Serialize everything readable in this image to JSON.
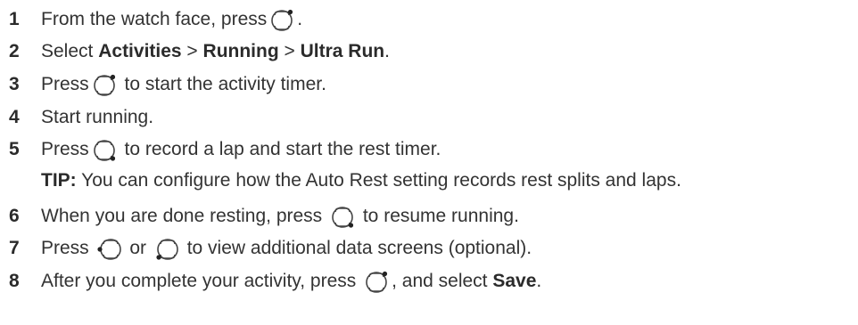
{
  "steps": [
    {
      "num": "1",
      "pre": "From the watch face, press ",
      "icon": "start-stop-button-icon",
      "post": "."
    },
    {
      "num": "2",
      "pre": "Select ",
      "b1": "Activities",
      "sep1": " > ",
      "b2": "Running",
      "sep2": " > ",
      "b3": "Ultra Run",
      "post": "."
    },
    {
      "num": "3",
      "pre": "Press ",
      "icon": "start-stop-button-icon",
      "post": " to start the activity timer."
    },
    {
      "num": "4",
      "pre": "Start running."
    },
    {
      "num": "5",
      "pre": "Press ",
      "icon": "back-lap-button-icon",
      "post": " to record a lap and start the rest timer."
    },
    {
      "num": "6",
      "pre": "When you are done resting, press ",
      "icon": "back-lap-button-icon",
      "post": " to resume running."
    },
    {
      "num": "7",
      "pre": "Press ",
      "icon1": "up-button-icon",
      "mid": " or ",
      "icon2": "down-button-icon",
      "post": " to view additional data screens (optional)."
    },
    {
      "num": "8",
      "pre": "After you complete your activity, press ",
      "icon": "start-stop-button-icon",
      "mid": ", and select ",
      "b1": "Save",
      "post": "."
    }
  ],
  "tip": {
    "label": "TIP:",
    "text": " You can configure how the Auto Rest setting records rest splits and laps."
  }
}
